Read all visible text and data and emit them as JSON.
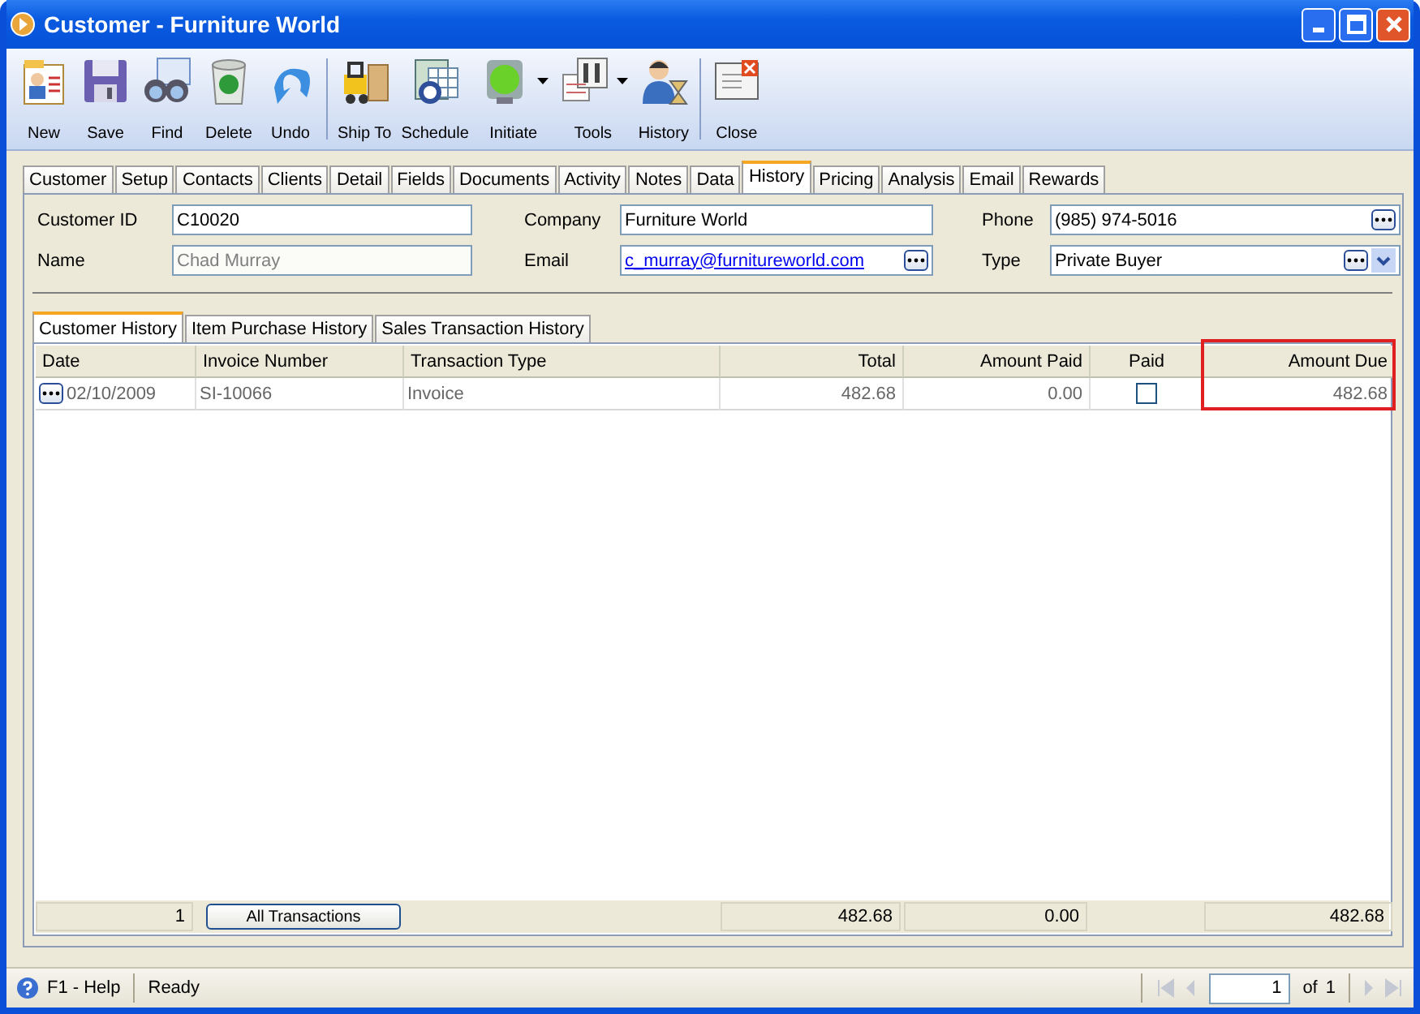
{
  "window": {
    "title": "Customer - Furniture World"
  },
  "toolbar": {
    "groups": [
      [
        {
          "label": "New",
          "has_menu": false
        },
        {
          "label": "Save",
          "has_menu": false
        },
        {
          "label": "Find",
          "has_menu": false
        },
        {
          "label": "Delete",
          "has_menu": false
        },
        {
          "label": "Undo",
          "has_menu": false
        }
      ],
      [
        {
          "label": "Ship To",
          "has_menu": false
        },
        {
          "label": "Schedule",
          "has_menu": false
        },
        {
          "label": "Initiate",
          "has_menu": true
        },
        {
          "label": "Tools",
          "has_menu": true
        },
        {
          "label": "History",
          "has_menu": false
        }
      ],
      [
        {
          "label": "Close",
          "has_menu": false
        }
      ]
    ]
  },
  "tabs": [
    {
      "label": "Customer",
      "selected": false
    },
    {
      "label": "Setup",
      "selected": false
    },
    {
      "label": "Contacts",
      "selected": false
    },
    {
      "label": "Clients",
      "selected": false
    },
    {
      "label": "Detail",
      "selected": false
    },
    {
      "label": "Fields",
      "selected": false
    },
    {
      "label": "Documents",
      "selected": false
    },
    {
      "label": "Activity",
      "selected": false
    },
    {
      "label": "Notes",
      "selected": false
    },
    {
      "label": "Data",
      "selected": false
    },
    {
      "label": "History",
      "selected": true
    },
    {
      "label": "Pricing",
      "selected": false
    },
    {
      "label": "Analysis",
      "selected": false
    },
    {
      "label": "Email",
      "selected": false
    },
    {
      "label": "Rewards",
      "selected": false
    }
  ],
  "form": {
    "fields": [
      {
        "label": "Customer ID",
        "value": "C10020",
        "kind": "text",
        "disabled": false
      },
      {
        "label": "Company",
        "value": "Furniture World",
        "kind": "text",
        "disabled": false
      },
      {
        "label": "Phone",
        "value": "(985) 974-5016",
        "kind": "lookup",
        "disabled": false
      },
      {
        "label": "Name",
        "value": "Chad Murray",
        "kind": "text",
        "disabled": true
      },
      {
        "label": "Email",
        "value": "c_murray@furnitureworld.com",
        "kind": "link",
        "disabled": false
      },
      {
        "label": "Type",
        "value": "Private Buyer",
        "kind": "combo",
        "disabled": false
      }
    ]
  },
  "subtabs": [
    {
      "label": "Customer History",
      "selected": true
    },
    {
      "label": "Item Purchase History",
      "selected": false
    },
    {
      "label": "Sales Transaction History",
      "selected": false
    }
  ],
  "table": {
    "columns": [
      {
        "label": "Date",
        "highlighted": false
      },
      {
        "label": "Invoice Number",
        "highlighted": false
      },
      {
        "label": "Transaction Type",
        "highlighted": false
      },
      {
        "label": "Total",
        "highlighted": false
      },
      {
        "label": "Amount Paid",
        "highlighted": false
      },
      {
        "label": "Paid",
        "highlighted": false
      },
      {
        "label": "Amount Due",
        "highlighted": true
      }
    ],
    "rows": [
      {
        "date": "02/10/2009",
        "invoice_number": "SI-10066",
        "transaction_type": "Invoice",
        "total": "482.68",
        "amount_paid": "0.00",
        "paid": false,
        "amount_due": "482.68"
      }
    ],
    "footer": {
      "count": "1",
      "button": "All Transactions",
      "total": "482.68",
      "amount_paid": "0.00",
      "amount_due": "482.68"
    }
  },
  "status_bar": {
    "help": "F1 - Help",
    "status": "Ready",
    "page": "1",
    "of": "of",
    "pages": "1"
  }
}
